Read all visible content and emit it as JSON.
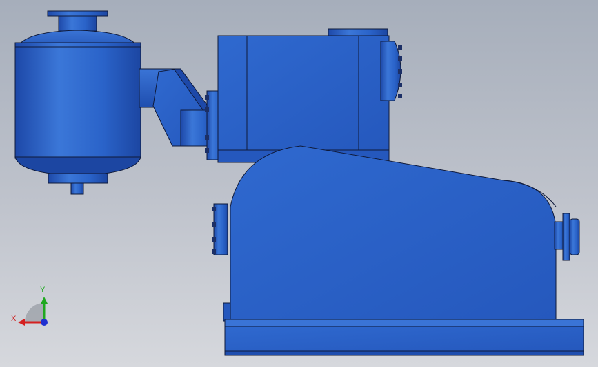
{
  "triad": {
    "x_label": "X",
    "y_label": "Y",
    "x_color": "#d42020",
    "y_color": "#1fa81f",
    "z_color": "#2030d0"
  },
  "model": {
    "part_color": "#2a63c9",
    "edge_color": "#0f1a3a",
    "components": [
      "vessel-tank",
      "elbow-pipe",
      "pump-housing",
      "gear-cover",
      "base-frame",
      "motor-shaft"
    ]
  }
}
